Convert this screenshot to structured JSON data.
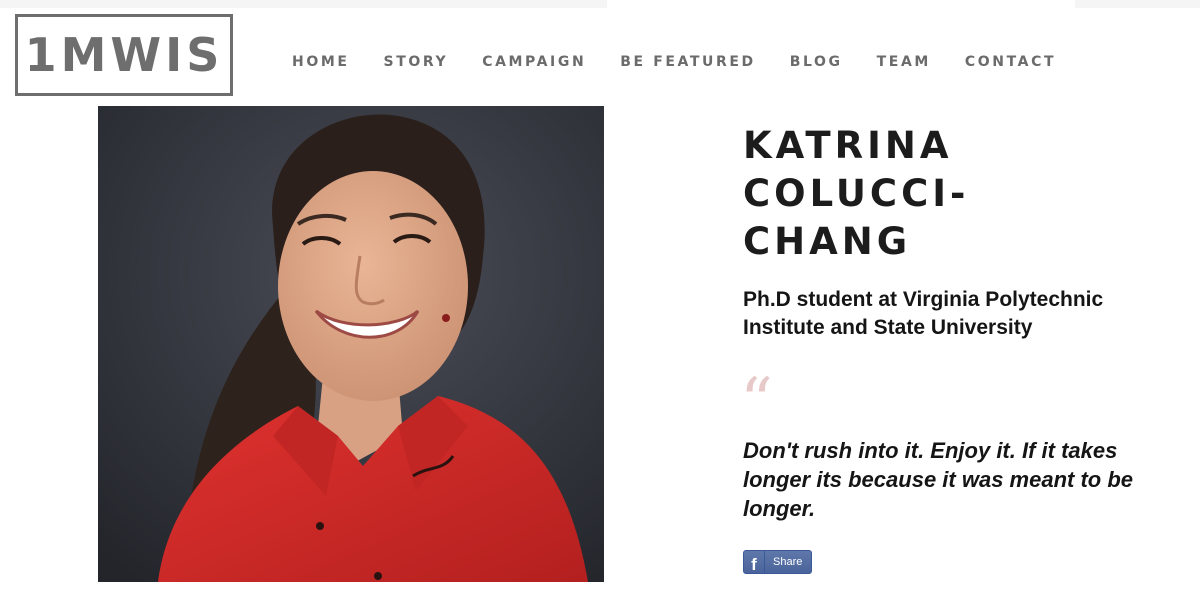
{
  "logo": {
    "text": "1MWIS"
  },
  "nav": {
    "items": [
      {
        "label": "HOME"
      },
      {
        "label": "STORY"
      },
      {
        "label": "CAMPAIGN"
      },
      {
        "label": "BE FEATURED"
      },
      {
        "label": "BLOG"
      },
      {
        "label": "TEAM"
      },
      {
        "label": "CONTACT"
      }
    ]
  },
  "profile": {
    "name_lines": [
      "KATRINA",
      "COLUCCI-",
      "CHANG"
    ],
    "subtitle_lines": [
      "Ph.D student at Virginia Polytechnic",
      "Institute and State University"
    ],
    "quote_mark": "“",
    "quote_lines": [
      "Don't rush into it. Enjoy it. If it takes",
      "longer its because it was meant to be",
      "longer."
    ]
  },
  "share": {
    "icon": "facebook-icon",
    "icon_glyph": "f",
    "label": "Share"
  },
  "colors": {
    "nav_text": "#6b6b6b",
    "logo_border": "#6e6e6e",
    "quote_mark": "#e8c9c9",
    "share_bg": "#4a639a"
  }
}
